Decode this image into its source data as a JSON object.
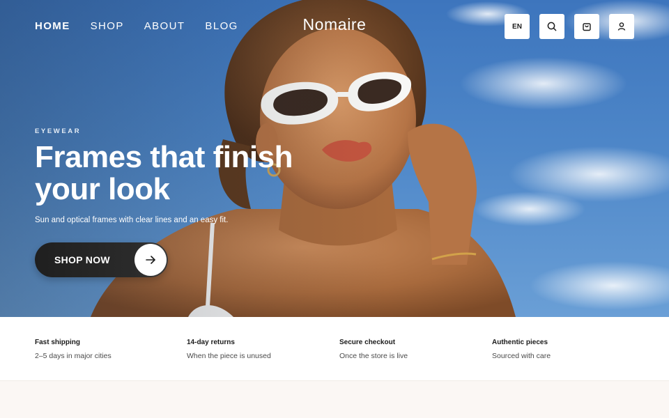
{
  "nav": {
    "links": [
      {
        "label": "HOME",
        "active": true
      },
      {
        "label": "SHOP",
        "active": false
      },
      {
        "label": "ABOUT",
        "active": false
      },
      {
        "label": "BLOG",
        "active": false
      }
    ]
  },
  "brand": {
    "name": "Nomaire"
  },
  "header_actions": {
    "language": "EN",
    "search_icon": "search-icon",
    "cart_icon": "shopping-bag-icon",
    "account_icon": "user-icon"
  },
  "hero": {
    "eyebrow": "EYEWEAR",
    "title_line1": "Frames that finish",
    "title_line2": "your look",
    "subtitle": "Sun and optical frames with clear lines and an easy fit.",
    "cta_label": "SHOP NOW",
    "cta_icon": "arrow-right-icon"
  },
  "features": [
    {
      "title": "Fast shipping",
      "text": "2–5 days in major cities"
    },
    {
      "title": "14-day returns",
      "text": "When the piece is unused"
    },
    {
      "title": "Secure checkout",
      "text": "Once the store is live"
    },
    {
      "title": "Authentic pieces",
      "text": "Sourced with care"
    }
  ],
  "colors": {
    "sky": "#4d86c8",
    "cta_background": "#1f1f1f",
    "feature_background": "#ffffff",
    "page_background": "#fbf7f4",
    "frame_white": "#f7f7f5"
  }
}
